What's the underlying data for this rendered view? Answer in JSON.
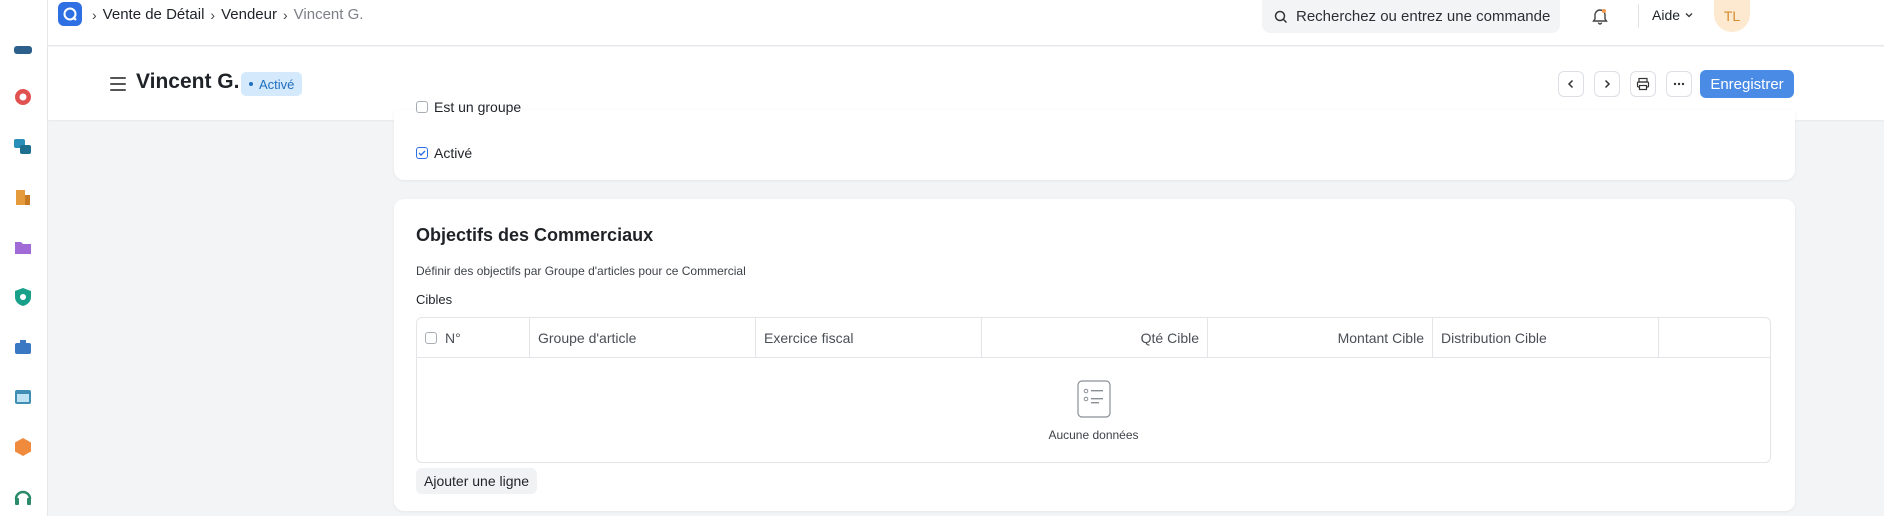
{
  "breadcrumb": {
    "items": [
      "Vente de Détail",
      "Vendeur"
    ],
    "current": "Vincent G."
  },
  "search": {
    "placeholder": "Recherchez ou entrez une commande"
  },
  "help": {
    "label": "Aide"
  },
  "user": {
    "initials": "TL"
  },
  "page": {
    "title": "Vincent G.",
    "status": "Activé",
    "save_label": "Enregistrer"
  },
  "details": {
    "is_group_label": "Est un groupe",
    "enabled_label": "Activé",
    "enabled_checked": true
  },
  "targets": {
    "title": "Objectifs des Commerciaux",
    "description": "Définir des objectifs par Groupe d'articles pour ce Commercial",
    "table_label": "Cibles",
    "columns": [
      "N°",
      "Groupe d'article",
      "Exercice fiscal",
      "Qté Cible",
      "Montant Cible",
      "Distribution Cible"
    ],
    "empty_text": "Aucune données",
    "add_row_label": "Ajouter une ligne"
  },
  "colors": {
    "primary": "#4a8be6",
    "badge_bg": "#d4e9fb",
    "badge_text": "#1f6fc0"
  }
}
